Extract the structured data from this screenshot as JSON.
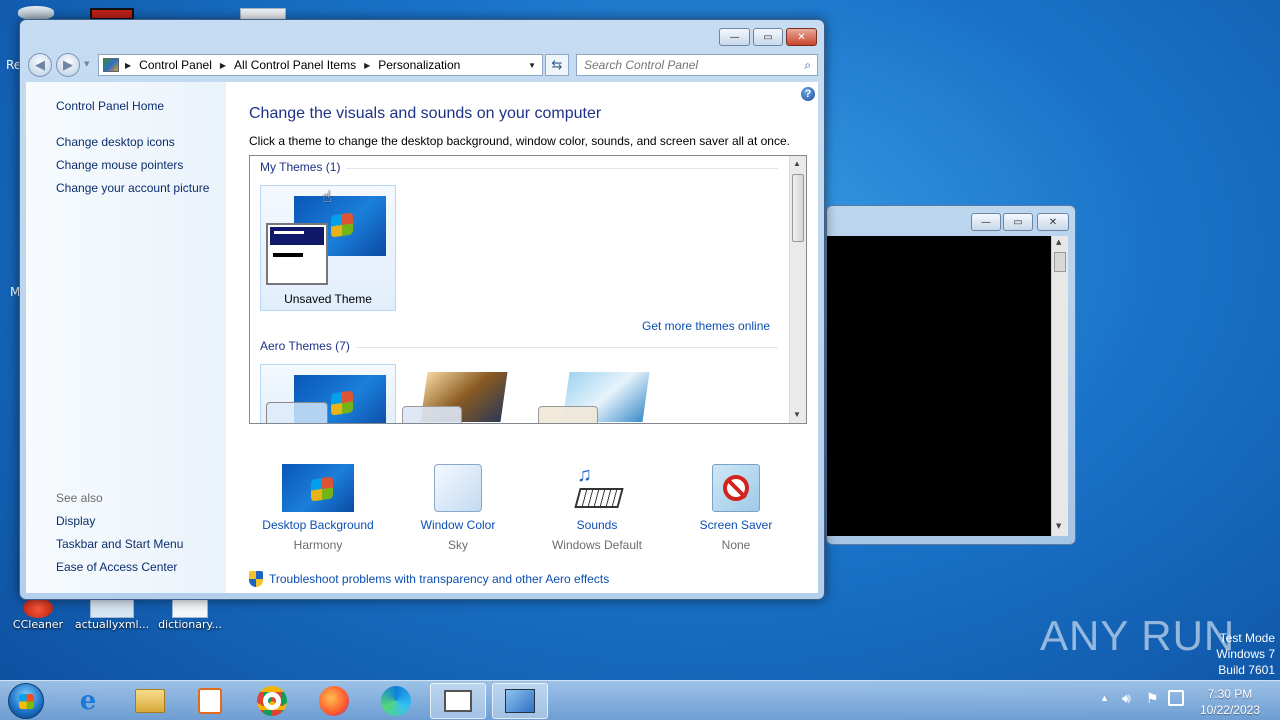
{
  "desktop": {
    "icons": [
      {
        "label": "CCleaner"
      },
      {
        "label": "actuallyxml..."
      },
      {
        "label": "dictionary..."
      }
    ],
    "left_edge_fragments": [
      "Re",
      "M"
    ],
    "watermark": {
      "line1": "Test Mode",
      "line2": "Windows 7",
      "line3": "Build 7601"
    },
    "brand": "ANY RUN"
  },
  "window": {
    "controls": {
      "minimize": "—",
      "maximize": "▭",
      "close": "✕"
    },
    "address": {
      "crumbs": [
        "Control Panel",
        "All Control Panel Items",
        "Personalization"
      ]
    },
    "search": {
      "placeholder": "Search Control Panel"
    },
    "left_pane": {
      "home": "Control Panel Home",
      "links": [
        "Change desktop icons",
        "Change mouse pointers",
        "Change your account picture"
      ],
      "see_also_label": "See also",
      "see_also": [
        "Display",
        "Taskbar and Start Menu",
        "Ease of Access Center"
      ]
    },
    "main": {
      "title": "Change the visuals and sounds on your computer",
      "description": "Click a theme to change the desktop background, window color, sounds, and screen saver all at once.",
      "my_themes_header": "My Themes (1)",
      "unsaved_theme": "Unsaved Theme",
      "get_more_link": "Get more themes online",
      "aero_header": "Aero Themes (7)",
      "bottom_items": [
        {
          "label": "Desktop Background",
          "value": "Harmony"
        },
        {
          "label": "Window Color",
          "value": "Sky"
        },
        {
          "label": "Sounds",
          "value": "Windows Default"
        },
        {
          "label": "Screen Saver",
          "value": "None"
        }
      ],
      "troubleshoot_link": "Troubleshoot problems with transparency and other Aero effects",
      "help": "?"
    }
  },
  "taskbar": {
    "clock_time": "7:30 PM",
    "clock_date": "10/22/2023"
  }
}
